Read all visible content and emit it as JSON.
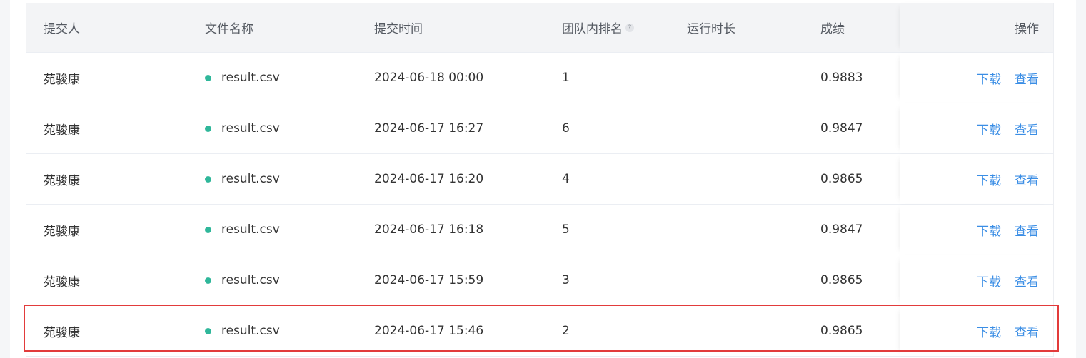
{
  "headers": {
    "submitter": "提交人",
    "file_name": "文件名称",
    "submit_time": "提交时间",
    "team_rank": "团队内排名",
    "runtime": "运行时长",
    "score": "成绩",
    "operations": "操作"
  },
  "help_icon": "question-mark-icon",
  "colors": {
    "status_dot": "#2fb79a",
    "link": "#3b8ee5",
    "highlight": "#e23b3b"
  },
  "rows": [
    {
      "submitter": "苑骏康",
      "file": "result.csv",
      "time": "2024-06-18 00:00",
      "rank": "1",
      "runtime": "",
      "score": "0.9883",
      "download": "下载",
      "view": "查看"
    },
    {
      "submitter": "苑骏康",
      "file": "result.csv",
      "time": "2024-06-17 16:27",
      "rank": "6",
      "runtime": "",
      "score": "0.9847",
      "download": "下载",
      "view": "查看"
    },
    {
      "submitter": "苑骏康",
      "file": "result.csv",
      "time": "2024-06-17 16:20",
      "rank": "4",
      "runtime": "",
      "score": "0.9865",
      "download": "下载",
      "view": "查看"
    },
    {
      "submitter": "苑骏康",
      "file": "result.csv",
      "time": "2024-06-17 16:18",
      "rank": "5",
      "runtime": "",
      "score": "0.9847",
      "download": "下载",
      "view": "查看"
    },
    {
      "submitter": "苑骏康",
      "file": "result.csv",
      "time": "2024-06-17 15:59",
      "rank": "3",
      "runtime": "",
      "score": "0.9865",
      "download": "下载",
      "view": "查看"
    },
    {
      "submitter": "苑骏康",
      "file": "result.csv",
      "time": "2024-06-17 15:46",
      "rank": "2",
      "runtime": "",
      "score": "0.9865",
      "download": "下载",
      "view": "查看"
    }
  ]
}
